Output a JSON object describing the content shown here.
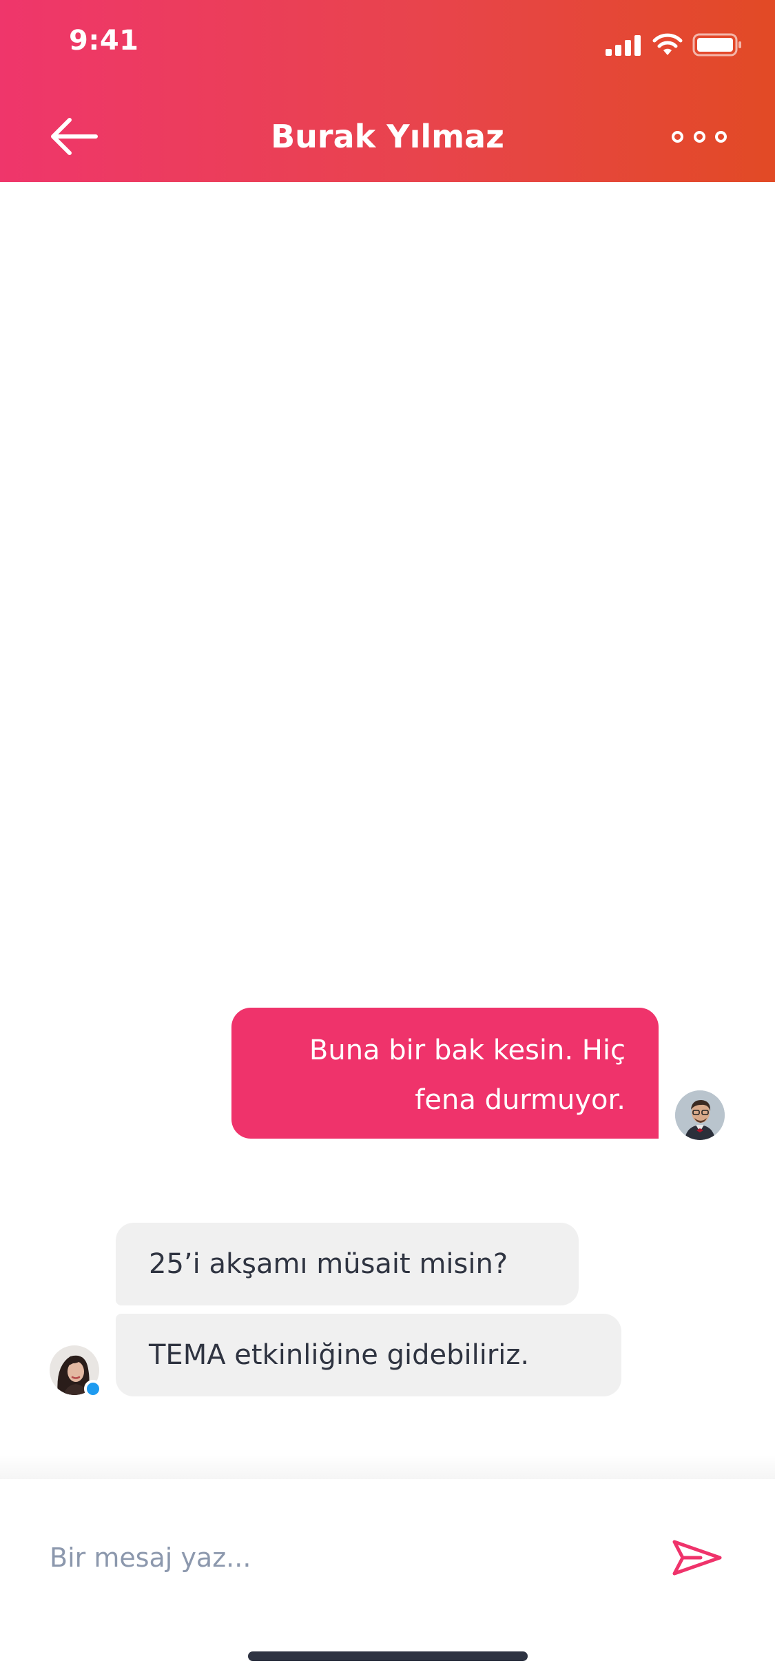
{
  "status_bar": {
    "time": "9:41"
  },
  "nav": {
    "title": "Burak Yılmaz"
  },
  "messages": {
    "outgoing": {
      "line1": "Buna bir bak kesin. Hiç",
      "line2": "fena durmuyor."
    },
    "incoming": [
      {
        "text": "25’i akşamı müsait misin?"
      },
      {
        "text": "TEMA etkinliğine gidebiliriz."
      }
    ]
  },
  "composer": {
    "placeholder": "Bir mesaj yaz..."
  },
  "colors": {
    "header_gradient_start": "#ef366b",
    "header_gradient_end": "#e24a25",
    "outgoing_bubble": "#ef336b",
    "incoming_bubble": "#f0f0f0",
    "online_indicator": "#1e9bf0",
    "send_icon": "#ef336b"
  },
  "icons": {
    "back": "arrow-left-icon",
    "more": "more-horizontal-icon",
    "send": "send-icon",
    "signal": "cellular-signal-icon",
    "wifi": "wifi-icon",
    "battery": "battery-icon"
  }
}
